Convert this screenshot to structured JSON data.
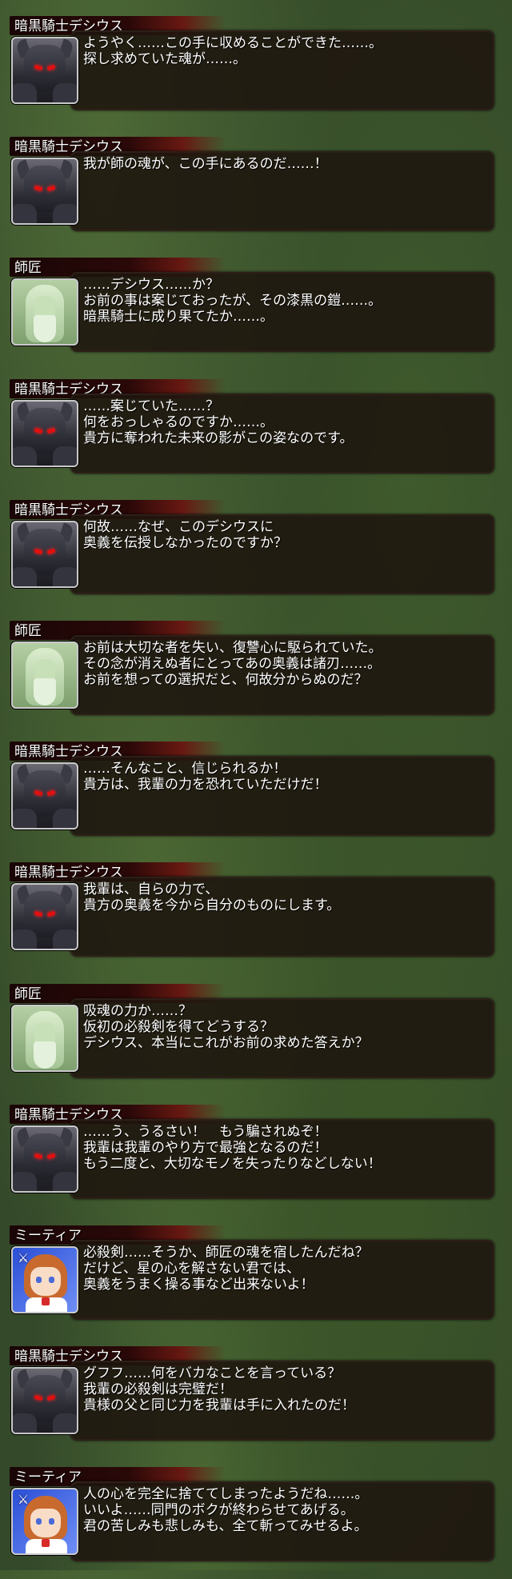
{
  "entries": [
    {
      "speaker": "暗黒騎士デシウス",
      "portrait": "dark-knight",
      "lines": [
        "ようやく……この手に収めることができた……。",
        "探し求めていた魂が……。"
      ]
    },
    {
      "speaker": "暗黒騎士デシウス",
      "portrait": "dark-knight",
      "lines": [
        "我が師の魂が、この手にあるのだ……！"
      ]
    },
    {
      "speaker": "師匠",
      "portrait": "master",
      "lines": [
        "……デシウス……か？",
        "お前の事は案じておったが、その漆黒の鎧……。",
        "暗黒騎士に成り果てたか……。"
      ]
    },
    {
      "speaker": "暗黒騎士デシウス",
      "portrait": "dark-knight",
      "lines": [
        "……案じていた……？",
        "何をおっしゃるのですか……。",
        "貴方に奪われた未来の影がこの姿なのです。"
      ]
    },
    {
      "speaker": "暗黒騎士デシウス",
      "portrait": "dark-knight",
      "lines": [
        "何故……なぜ、このデシウスに",
        "奥義を伝授しなかったのですか？"
      ]
    },
    {
      "speaker": "師匠",
      "portrait": "master",
      "lines": [
        "お前は大切な者を失い、復讐心に駆られていた。",
        "その念が消えぬ者にとってあの奥義は諸刃……。",
        "お前を想っての選択だと、何故分からぬのだ？"
      ]
    },
    {
      "speaker": "暗黒騎士デシウス",
      "portrait": "dark-knight",
      "lines": [
        "……そんなこと、信じられるか！",
        "貴方は、我輩の力を恐れていただけだ！"
      ]
    },
    {
      "speaker": "暗黒騎士デシウス",
      "portrait": "dark-knight",
      "lines": [
        "我輩は、自らの力で、",
        "貴方の奥義を今から自分のものにします。"
      ]
    },
    {
      "speaker": "師匠",
      "portrait": "master",
      "lines": [
        "吸魂の力か……？",
        "仮初の必殺剣を得てどうする？",
        "デシウス、本当にこれがお前の求めた答えか？"
      ]
    },
    {
      "speaker": "暗黒騎士デシウス",
      "portrait": "dark-knight",
      "lines": [
        "……う、うるさい！　もう騙されぬぞ！",
        "我輩は我輩のやり方で最強となるのだ！",
        "もう二度と、大切なモノを失ったりなどしない！"
      ]
    },
    {
      "speaker": "ミーティア",
      "portrait": "myria",
      "lines": [
        "必殺剣……そうか、師匠の魂を宿したんだね？",
        "だけど、星の心を解さない君では、",
        "奥義をうまく操る事など出来ないよ！"
      ]
    },
    {
      "speaker": "暗黒騎士デシウス",
      "portrait": "dark-knight",
      "lines": [
        "グフフ……何をバカなことを言っている？",
        "我輩の必殺剣は完璧だ！",
        "貴様の父と同じ力を我輩は手に入れたのだ！"
      ]
    },
    {
      "speaker": "ミーティア",
      "portrait": "myria",
      "lines": [
        "人の心を完全に捨ててしまったようだね……。",
        "いいよ……同門のボクが終わらせてあげる。",
        "君の苦しみも悲しみも、全て斬ってみせるよ。"
      ]
    }
  ]
}
